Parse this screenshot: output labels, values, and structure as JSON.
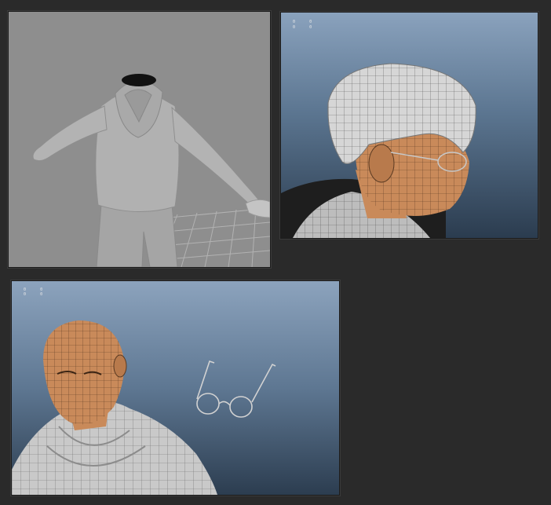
{
  "viewports": [
    {
      "name": "viewport-body",
      "icons": [
        "sweater-mesh-icon",
        "floor-grid-icon"
      ]
    },
    {
      "name": "viewport-head-hair",
      "hud": {
        "row1": [
          "0",
          "0"
        ],
        "row2": [
          "0",
          "0"
        ]
      },
      "icons": [
        "hair-mesh-icon",
        "glasses-icon"
      ]
    },
    {
      "name": "viewport-head-glasses",
      "hud": {
        "row1": [
          "0",
          "0"
        ],
        "row2": [
          "0",
          "0"
        ]
      },
      "icons": [
        "bald-head-mesh-icon",
        "glasses-icon"
      ]
    }
  ],
  "colors": {
    "background": "#2a2a2a",
    "grey_viewport": "#8e8e8e",
    "skin": "#c98a5a",
    "wireframe": "#3c3c3c"
  }
}
